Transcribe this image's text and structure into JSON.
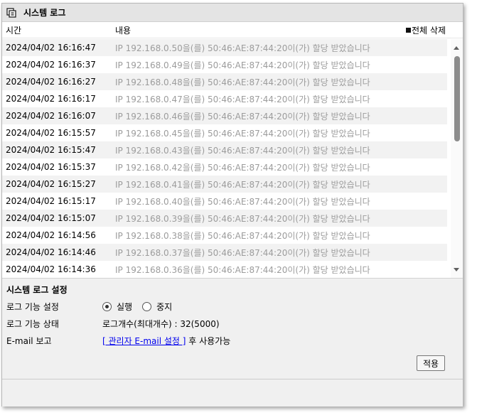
{
  "window": {
    "title": "시스템 로그"
  },
  "columns": {
    "time": "시간",
    "content": "내용",
    "delete_all": "전체 삭제"
  },
  "logs": [
    {
      "time": "2024/04/02 16:16:47",
      "message": "IP 192.168.0.50을(를) 50:46:AE:87:44:20이(가) 할당 받았습니다"
    },
    {
      "time": "2024/04/02 16:16:37",
      "message": "IP 192.168.0.49을(를) 50:46:AE:87:44:20이(가) 할당 받았습니다"
    },
    {
      "time": "2024/04/02 16:16:27",
      "message": "IP 192.168.0.48을(를) 50:46:AE:87:44:20이(가) 할당 받았습니다"
    },
    {
      "time": "2024/04/02 16:16:17",
      "message": "IP 192.168.0.47을(를) 50:46:AE:87:44:20이(가) 할당 받았습니다"
    },
    {
      "time": "2024/04/02 16:16:07",
      "message": "IP 192.168.0.46을(를) 50:46:AE:87:44:20이(가) 할당 받았습니다"
    },
    {
      "time": "2024/04/02 16:15:57",
      "message": "IP 192.168.0.45을(를) 50:46:AE:87:44:20이(가) 할당 받았습니다"
    },
    {
      "time": "2024/04/02 16:15:47",
      "message": "IP 192.168.0.43을(를) 50:46:AE:87:44:20이(가) 할당 받았습니다"
    },
    {
      "time": "2024/04/02 16:15:37",
      "message": "IP 192.168.0.42을(를) 50:46:AE:87:44:20이(가) 할당 받았습니다"
    },
    {
      "time": "2024/04/02 16:15:27",
      "message": "IP 192.168.0.41을(를) 50:46:AE:87:44:20이(가) 할당 받았습니다"
    },
    {
      "time": "2024/04/02 16:15:17",
      "message": "IP 192.168.0.40을(를) 50:46:AE:87:44:20이(가) 할당 받았습니다"
    },
    {
      "time": "2024/04/02 16:15:07",
      "message": "IP 192.168.0.39을(를) 50:46:AE:87:44:20이(가) 할당 받았습니다"
    },
    {
      "time": "2024/04/02 16:14:56",
      "message": "IP 192.168.0.38을(를) 50:46:AE:87:44:20이(가) 할당 받았습니다"
    },
    {
      "time": "2024/04/02 16:14:46",
      "message": "IP 192.168.0.37을(를) 50:46:AE:87:44:20이(가) 할당 받았습니다"
    },
    {
      "time": "2024/04/02 16:14:36",
      "message": "IP 192.168.0.36을(를) 50:46:AE:87:44:20이(가) 할당 받았습니다"
    }
  ],
  "settings": {
    "heading": "시스템 로그 설정",
    "function_label": "로그 기능 설정",
    "run_label": "실행",
    "stop_label": "중지",
    "selected": "run",
    "status_label": "로그 기능 상태",
    "status_value": "로그개수(최대개수) : 32(5000)",
    "email_label": "E-mail 보고",
    "email_link": "[ 관리자 E-mail 설정 ]",
    "email_suffix": " 후 사용가능",
    "apply_label": "적용"
  },
  "icons": {
    "title": "window-stack-icon",
    "delete": "square-icon",
    "scroll_up": "triangle-up-icon",
    "scroll_down": "triangle-down-icon"
  }
}
